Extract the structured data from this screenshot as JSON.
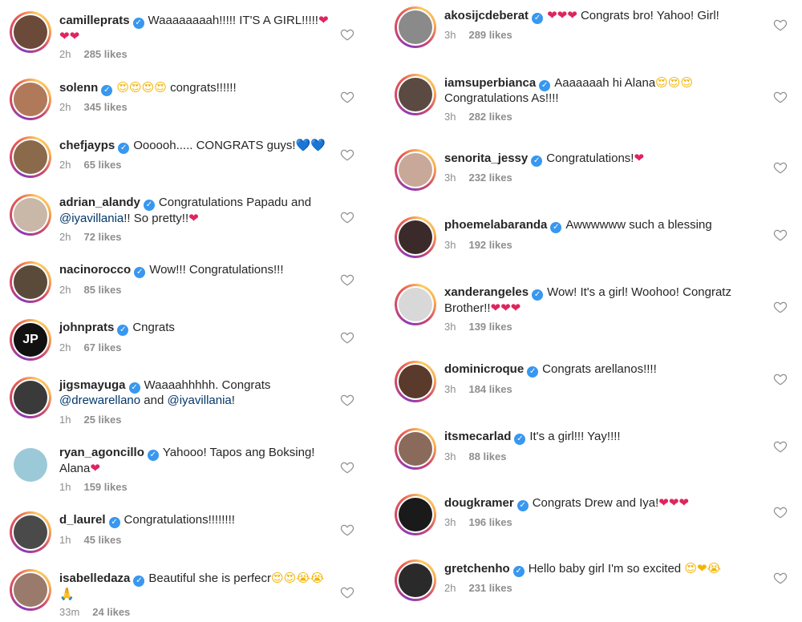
{
  "left": [
    {
      "user": "camilleprats",
      "text": "Waaaaaaaah!!!!! IT'S A GIRL!!!!!",
      "emoji": "❤❤❤",
      "time": "2h",
      "likes": "285 likes",
      "avatar_color": "#6b4a3a",
      "ring": true
    },
    {
      "user": "solenn",
      "text": "congrats!!!!!!",
      "emoji_before": "😍😍😍😍",
      "time": "2h",
      "likes": "345 likes",
      "avatar_color": "#b07a5a",
      "ring": true
    },
    {
      "user": "chefjayps",
      "text": "Oooooh..... CONGRATS guys!",
      "emoji": "💙💙",
      "time": "2h",
      "likes": "65 likes",
      "avatar_color": "#8a6a4a",
      "ring": true
    },
    {
      "user": "adrian_alandy",
      "text": "Congratulations Papadu and",
      "mention": "@iyavillania",
      "text2": "!! So pretty!!",
      "emoji": "❤",
      "time": "2h",
      "likes": "72 likes",
      "avatar_color": "#c9b8a8",
      "ring": true
    },
    {
      "user": "nacinorocco",
      "text": "Wow!!! Congratulations!!!",
      "time": "2h",
      "likes": "85 likes",
      "avatar_color": "#5a4a3a",
      "ring": true
    },
    {
      "user": "johnprats",
      "text": "Cngrats",
      "time": "2h",
      "likes": "67 likes",
      "avatar_color": "#111111",
      "ring": true,
      "avatar_text": "JP"
    },
    {
      "user": "jigsmayuga",
      "text": "Waaaahhhhh. Congrats",
      "mention": "@drewarellano",
      "text2": " and ",
      "mention2": "@iyavillania",
      "text3": "!",
      "time": "1h",
      "likes": "25 likes",
      "avatar_color": "#3a3a3a",
      "ring": true
    },
    {
      "user": "ryan_agoncillo",
      "text": "Yahooo! Tapos ang Boksing! Alana",
      "emoji": "❤",
      "time": "1h",
      "likes": "159 likes",
      "avatar_color": "#9cc9d8",
      "ring": false
    },
    {
      "user": "d_laurel",
      "text": "Congratulations!!!!!!!!",
      "time": "1h",
      "likes": "45 likes",
      "avatar_color": "#4a4a4a",
      "ring": true
    },
    {
      "user": "isabelledaza",
      "text": "Beautiful she is perfecr",
      "emoji": "😍😍😭😭",
      "emoji_line2": "🙏",
      "time": "33m",
      "likes": "24 likes",
      "avatar_color": "#9a7a6a",
      "ring": true
    }
  ],
  "right": [
    {
      "user": "akosijcdeberat",
      "emoji_before": "❤❤❤",
      "text": "Congrats bro! Yahoo! Girl!",
      "time": "3h",
      "likes": "289 likes",
      "avatar_color": "#8a8a8a",
      "ring": true
    },
    {
      "user": "iamsuperbianca",
      "text": "Aaaaaaah hi Alana",
      "emoji": "😍😍😍",
      "line2": "Congratulations As!!!!",
      "time": "3h",
      "likes": "282 likes",
      "avatar_color": "#5a4a42",
      "ring": true
    },
    {
      "user": "senorita_jessy",
      "text": "Congratulations!",
      "emoji": "❤",
      "time": "3h",
      "likes": "232 likes",
      "avatar_color": "#c8a898",
      "ring": true
    },
    {
      "user": "phoemelabaranda",
      "text": "Awwwwww such a blessing",
      "time": "3h",
      "likes": "192 likes",
      "avatar_color": "#3a2a2a",
      "ring": true
    },
    {
      "user": "xanderangeles",
      "text": "Wow! It's a girl! Woohoo! Congratz",
      "line2": "Brother!!",
      "emoji_line2": "❤❤❤",
      "time": "3h",
      "likes": "139 likes",
      "avatar_color": "#d8d8d8",
      "ring": true
    },
    {
      "user": "dominicroque",
      "text": "Congrats arellanos!!!!",
      "time": "3h",
      "likes": "184 likes",
      "avatar_color": "#5a3a2a",
      "ring": true
    },
    {
      "user": "itsmecarlad",
      "text": "It's a girl!!! Yay!!!!",
      "time": "3h",
      "likes": "88 likes",
      "avatar_color": "#8a6a5a",
      "ring": true
    },
    {
      "user": "dougkramer",
      "text": "Congrats Drew and Iya!",
      "emoji": "❤❤❤",
      "time": "3h",
      "likes": "196 likes",
      "avatar_color": "#1a1a1a",
      "ring": true
    },
    {
      "user": "gretchenho",
      "text": "Hello baby girl",
      "emoji": "😍❤",
      "text2": " I'm so excited ",
      "emoji2": "😭",
      "time": "2h",
      "likes": "231 likes",
      "avatar_color": "#2a2a2a",
      "ring": true
    }
  ],
  "icons": {
    "heart": "heart-outline-icon",
    "verified": "verified-badge-icon"
  },
  "colors": {
    "verified": "#3897f0",
    "muted": "#8e8e8e",
    "mention": "#00376b",
    "heart": "#e0245e"
  }
}
